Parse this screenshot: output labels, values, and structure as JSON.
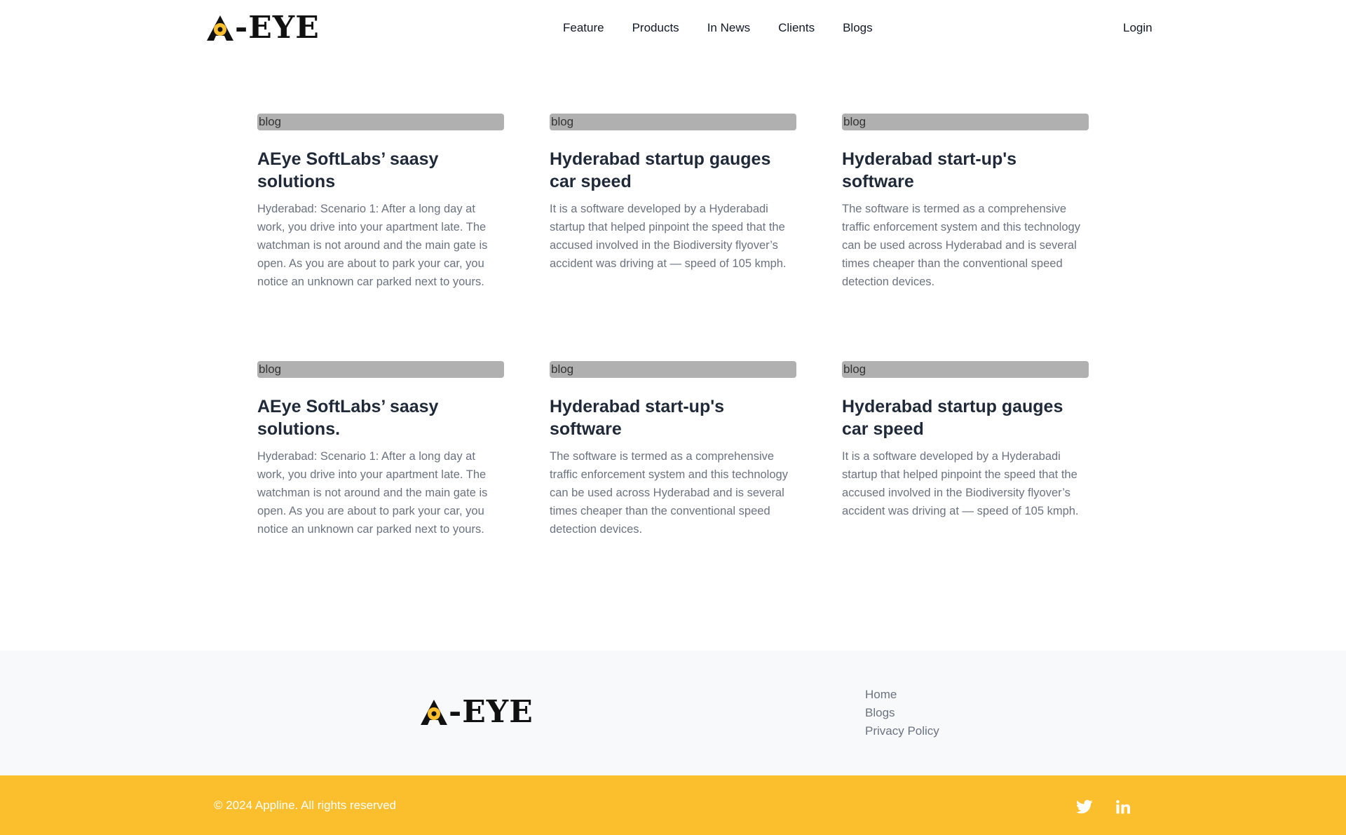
{
  "brand": {
    "logo_text": "-EYE",
    "accent_color": "#fbbf2e"
  },
  "nav": {
    "items": [
      {
        "label": "Feature"
      },
      {
        "label": "Products"
      },
      {
        "label": "In News"
      },
      {
        "label": "Clients"
      },
      {
        "label": "Blogs"
      }
    ],
    "login_label": "Login"
  },
  "blogs": [
    {
      "img_alt": "blog",
      "title": "AEye SoftLabs’ saasy solutions",
      "desc": "Hyderabad: Scenario 1: After a long day at work, you drive into your apartment late. The watchman is not around and the main gate is open. As you are about to park your car, you notice an unknown car parked next to yours."
    },
    {
      "img_alt": "blog",
      "title": "Hyderabad startup gauges car speed",
      "desc": "It is a software developed by a Hyderabadi startup that helped pinpoint the speed that the accused involved in the Biodiversity flyover’s accident was driving at — speed of 105 kmph."
    },
    {
      "img_alt": "blog",
      "title": "Hyderabad start-up's software",
      "desc": "The software is termed as a comprehensive traffic enforcement system and this technology can be used across Hyderabad and is several times cheaper than the conventional speed detection devices."
    },
    {
      "img_alt": "blog",
      "title": "AEye SoftLabs’ saasy solutions.",
      "desc": "Hyderabad: Scenario 1: After a long day at work, you drive into your apartment late. The watchman is not around and the main gate is open. As you are about to park your car, you notice an unknown car parked next to yours."
    },
    {
      "img_alt": "blog",
      "title": "Hyderabad start-up's software",
      "desc": "The software is termed as a comprehensive traffic enforcement system and this technology can be used across Hyderabad and is several times cheaper than the conventional speed detection devices."
    },
    {
      "img_alt": "blog",
      "title": "Hyderabad startup gauges car speed",
      "desc": "It is a software developed by a Hyderabadi startup that helped pinpoint the speed that the accused involved in the Biodiversity flyover’s accident was driving at — speed of 105 kmph."
    }
  ],
  "footer": {
    "links": [
      {
        "label": "Home"
      },
      {
        "label": "Blogs"
      },
      {
        "label": "Privacy Policy"
      }
    ],
    "copyright": "© 2024 Appline. All rights reserved",
    "social": [
      {
        "icon": "twitter-icon"
      },
      {
        "icon": "linkedin-icon"
      }
    ]
  }
}
